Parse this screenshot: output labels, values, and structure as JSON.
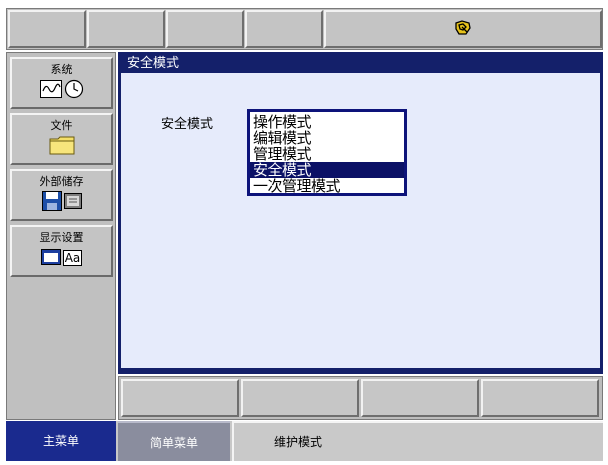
{
  "screen": {
    "nav": {
      "system": "系统",
      "file": "文件",
      "external_storage": "外部储存",
      "display_settings": "显示设置",
      "display_icon_text": "Aa"
    },
    "main": {
      "title": "安全模式",
      "field_label": "安全模式",
      "options": [
        "操作模式",
        "编辑模式",
        "管理模式",
        "安全模式",
        "一次管理模式"
      ],
      "selected_index": 3
    },
    "bottom": {
      "main_menu": "主菜单",
      "simple_menu": "简单菜单",
      "status": "维护模式"
    }
  },
  "colors": {
    "title_bar": "#14206a",
    "panel_bg": "#e6ebfb",
    "selected_item": "#0b1166",
    "main_menu_active": "#1a2a8e",
    "simple_menu": "#8a8d9e"
  }
}
